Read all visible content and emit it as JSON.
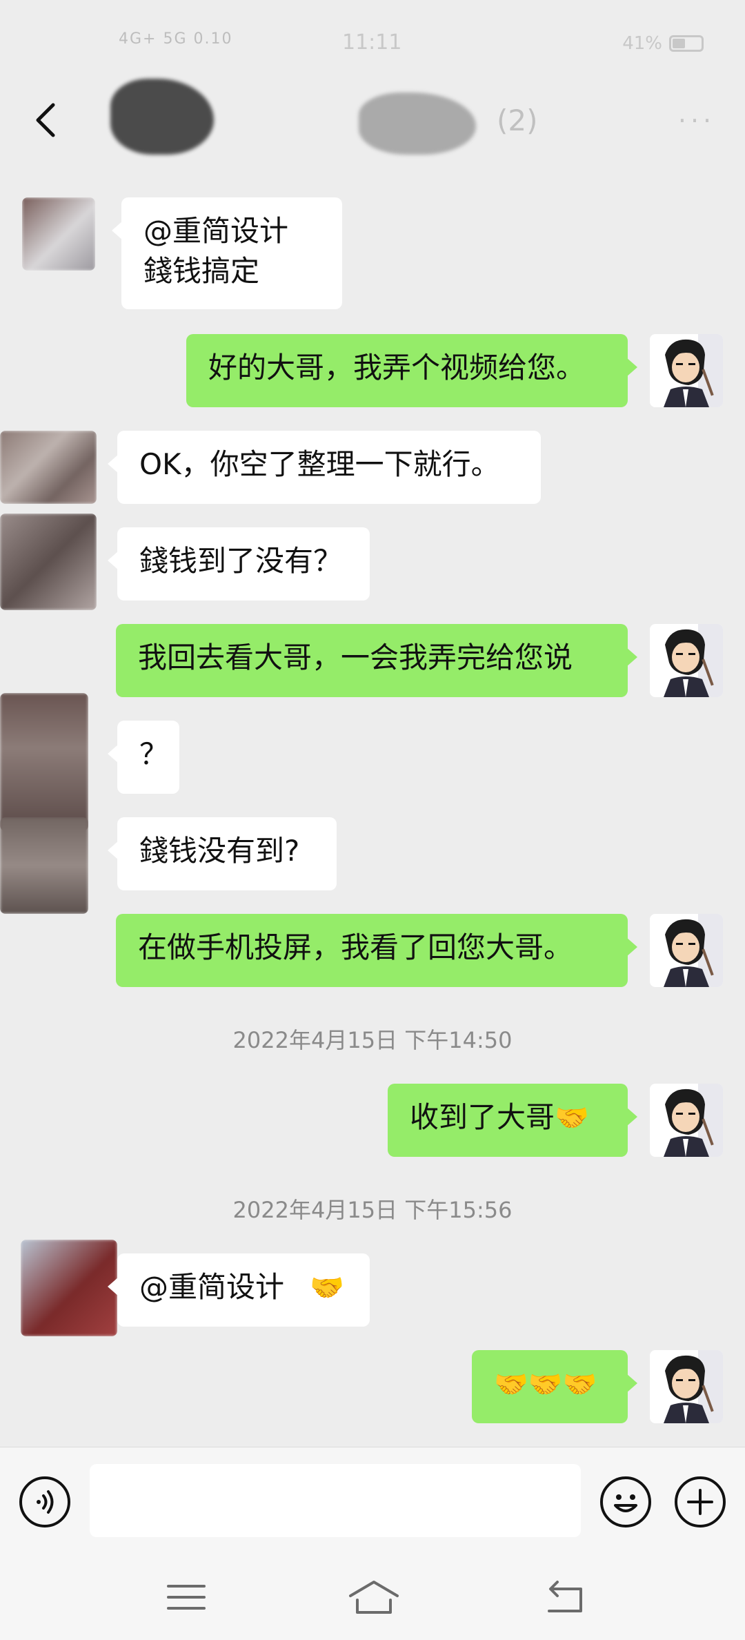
{
  "status_bar": {
    "network": "4G+ 5G",
    "speed": "0.10",
    "time": "11:11",
    "battery": "41%"
  },
  "header": {
    "title": "(2)",
    "back_icon": "chevron-left-icon",
    "more_icon": "more-dots-icon"
  },
  "messages": [
    {
      "side": "in",
      "lines": [
        "@重简设计",
        "錢钱搞定"
      ]
    },
    {
      "side": "out",
      "text": "好的大哥，我弄个视频给您。"
    },
    {
      "side": "in",
      "text": "OK，你空了整理一下就行。"
    },
    {
      "side": "in",
      "text": "錢钱到了没有？"
    },
    {
      "side": "out",
      "text": "我回去看大哥，一会我弄完给您说"
    },
    {
      "side": "in",
      "text": "？"
    },
    {
      "side": "in",
      "text": "錢钱没有到?"
    },
    {
      "side": "out",
      "text": "在做手机投屏，我看了回您大哥。"
    },
    {
      "type": "time",
      "text": "2022年4月15日 下午14:50"
    },
    {
      "side": "out",
      "text": "收到了大哥",
      "emoji": "🤝"
    },
    {
      "type": "time",
      "text": "2022年4月15日 下午15:56"
    },
    {
      "side": "in",
      "text": "@重简设计",
      "emoji": "🤝"
    },
    {
      "side": "out",
      "text": "",
      "emoji": "🤝🤝🤝"
    }
  ],
  "input_bar": {
    "placeholder": "",
    "voice_icon": "voice-icon",
    "emoji_icon": "emoji-icon",
    "plus_icon": "plus-icon"
  },
  "system_nav": {
    "menu_icon": "menu-icon",
    "home_icon": "home-icon",
    "back_icon": "back-icon"
  },
  "colors": {
    "background": "#ededed",
    "outgoing_bubble": "#95ec69",
    "incoming_bubble": "#ffffff",
    "timestamp": "#8a8a8a"
  }
}
